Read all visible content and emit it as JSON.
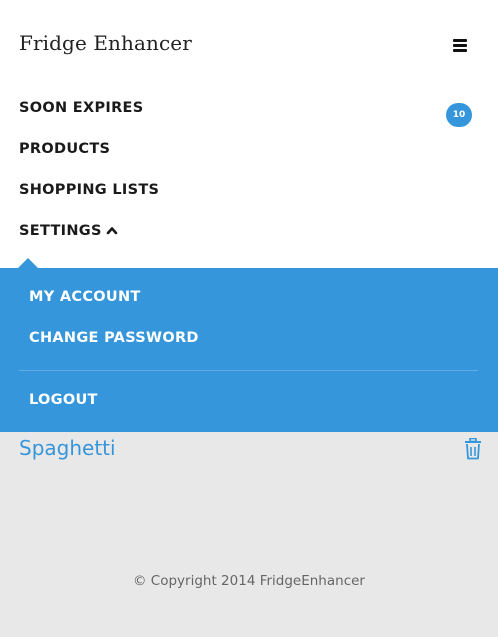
{
  "app": {
    "brand": "Fridge Enhancer"
  },
  "nav": {
    "items": [
      {
        "label": "SOON EXPIRES",
        "badge": "10"
      },
      {
        "label": "PRODUCTS"
      },
      {
        "label": "SHOPPING LISTS"
      },
      {
        "label": "SETTINGS",
        "icon": "chevron-up-icon",
        "expanded": true
      }
    ],
    "menu_icon": "hamburger-icon"
  },
  "settings_menu": {
    "items": [
      {
        "label": "MY ACCOUNT"
      },
      {
        "label": "CHANGE PASSWORD"
      },
      {
        "label": "LOGOUT"
      }
    ]
  },
  "content": {
    "items": [
      {
        "name": "Spaghetti",
        "action_icon": "trash-icon"
      }
    ]
  },
  "footer": {
    "text": "© Copyright 2014 FridgeEnhancer"
  },
  "colors": {
    "accent": "#3596db",
    "background": "#e8e8e8",
    "nav_background": "#ffffff",
    "nav_text": "#1a1a1a"
  }
}
